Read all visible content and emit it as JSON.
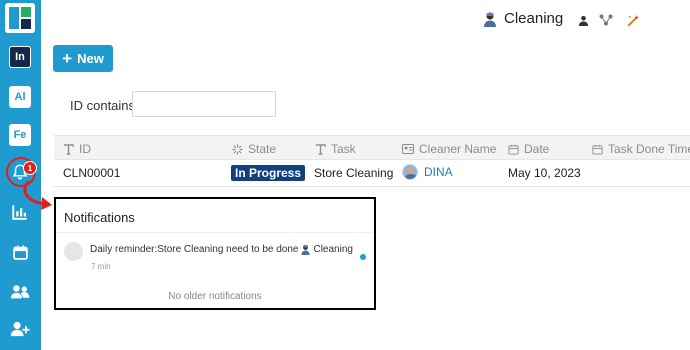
{
  "header": {
    "title": "Cleaning",
    "title_icon": "cleaner-emoji-icon",
    "icons": [
      "user-icon",
      "share-icon",
      "magic-wand-icon"
    ]
  },
  "sidebar": {
    "logo": "app-logo",
    "apps": [
      {
        "label": "In",
        "active": true
      },
      {
        "label": "Al",
        "active": false
      },
      {
        "label": "Fe",
        "active": false
      }
    ],
    "notification_badge": "1",
    "icons": [
      "bell-icon",
      "chart-icon",
      "calendar-icon",
      "users-icon",
      "add-user-icon"
    ]
  },
  "toolbar": {
    "new_label": "New"
  },
  "filter": {
    "label": "ID  contains",
    "value": ""
  },
  "table": {
    "columns": [
      {
        "label": "ID",
        "icon": "text-icon"
      },
      {
        "label": "State",
        "icon": "loading-icon"
      },
      {
        "label": "Task",
        "icon": "text-icon"
      },
      {
        "label": "Cleaner Name",
        "icon": "id-card-icon"
      },
      {
        "label": "Date",
        "icon": "calendar-icon"
      },
      {
        "label": "Task Done Time",
        "icon": "calendar-icon"
      }
    ],
    "rows": [
      {
        "id": "CLN00001",
        "state": "In Progress",
        "task": "Store Cleaning",
        "cleaner": "DINA",
        "date": "May 10, 2023",
        "done_time": ""
      }
    ]
  },
  "notifications": {
    "title": "Notifications",
    "items": [
      {
        "text_before": "Daily reminder:Store Cleaning need to be done",
        "text_after": "Cleaning",
        "time": "7 min",
        "unread": true
      }
    ],
    "footer": "No older notifications"
  },
  "colors": {
    "accent": "#1f9bcf",
    "state_badge": "#12407e",
    "highlight_red": "#e01f1f"
  }
}
